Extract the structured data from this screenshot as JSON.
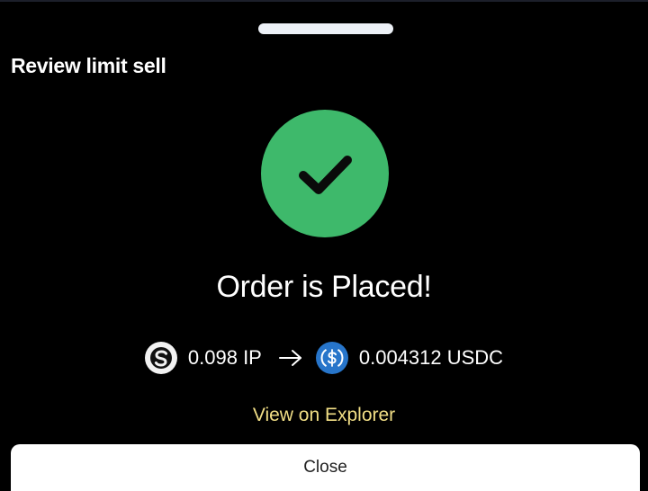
{
  "sheet": {
    "title": "Review limit sell"
  },
  "status": {
    "message": "Order is Placed!",
    "icon": "check-icon",
    "color": "#3eb96b"
  },
  "swap": {
    "from": {
      "amount": "0.098 IP",
      "icon": "ip-token-icon"
    },
    "to": {
      "amount": "0.004312 USDC",
      "icon": "usdc-token-icon",
      "color": "#2775ca"
    }
  },
  "links": {
    "explorer_label": "View on Explorer",
    "color": "#f2df86"
  },
  "actions": {
    "close_label": "Close"
  }
}
